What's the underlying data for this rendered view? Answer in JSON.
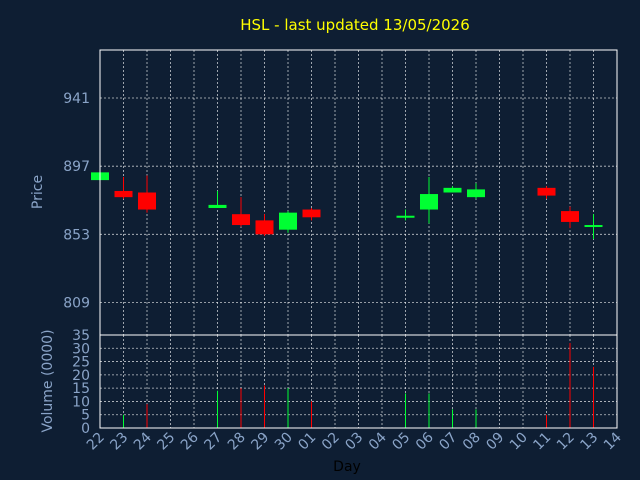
{
  "chart_data": {
    "type": "candlestick",
    "title": "HSL - last updated 13/05/2026",
    "xlabel": "Day",
    "ylabel_price": "Price",
    "ylabel_volume": "Volume (0000)",
    "price_ticks": [
      809,
      853,
      897,
      941
    ],
    "price_range": [
      788,
      972
    ],
    "volume_ticks": [
      0,
      5,
      10,
      15,
      20,
      25,
      30,
      35
    ],
    "volume_range": [
      0,
      35
    ],
    "x_tick_labels": [
      "22",
      "23",
      "24",
      "25",
      "26",
      "27",
      "28",
      "29",
      "30",
      "01",
      "02",
      "03",
      "04",
      "05",
      "06",
      "07",
      "08",
      "09",
      "10",
      "11",
      "12",
      "13",
      "14"
    ],
    "grid": true,
    "colors": {
      "up": "#00ff33",
      "down": "#ff0000",
      "title": "#ffff00",
      "ticks": "#8aa4c8",
      "background": "#0e1e33"
    },
    "candles": [
      {
        "day": "22",
        "open": 888,
        "close": 893,
        "high": 893,
        "low": 888
      },
      {
        "day": "23",
        "open": 881,
        "close": 877,
        "high": 890,
        "low": 876
      },
      {
        "day": "24",
        "open": 880,
        "close": 869,
        "high": 891,
        "low": 867
      },
      {
        "day": "27",
        "open": 870,
        "close": 872,
        "high": 881,
        "low": 870
      },
      {
        "day": "28",
        "open": 866,
        "close": 859,
        "high": 877,
        "low": 858
      },
      {
        "day": "29",
        "open": 862,
        "close": 853,
        "high": 866,
        "low": 852
      },
      {
        "day": "30",
        "open": 856,
        "close": 867,
        "high": 868,
        "low": 854
      },
      {
        "day": "01",
        "open": 869,
        "close": 864,
        "high": 870,
        "low": 862
      },
      {
        "day": "05",
        "open": 864,
        "close": 865,
        "high": 869,
        "low": 862
      },
      {
        "day": "06",
        "open": 869,
        "close": 879,
        "high": 890,
        "low": 860
      },
      {
        "day": "07",
        "open": 880,
        "close": 883,
        "high": 884,
        "low": 880
      },
      {
        "day": "08",
        "open": 877,
        "close": 882,
        "high": 886,
        "low": 876
      },
      {
        "day": "11",
        "open": 883,
        "close": 878,
        "high": 884,
        "low": 876
      },
      {
        "day": "12",
        "open": 868,
        "close": 861,
        "high": 871,
        "low": 857
      },
      {
        "day": "13",
        "open": 859,
        "close": 859,
        "high": 866,
        "low": 850
      }
    ],
    "volumes": [
      {
        "day": "22",
        "value": 0,
        "dir": "up"
      },
      {
        "day": "23",
        "value": 5,
        "dir": "up"
      },
      {
        "day": "24",
        "value": 9,
        "dir": "down"
      },
      {
        "day": "27",
        "value": 14,
        "dir": "up"
      },
      {
        "day": "28",
        "value": 15,
        "dir": "down"
      },
      {
        "day": "29",
        "value": 16,
        "dir": "down"
      },
      {
        "day": "30",
        "value": 15,
        "dir": "up"
      },
      {
        "day": "01",
        "value": 10,
        "dir": "down"
      },
      {
        "day": "05",
        "value": 13,
        "dir": "up"
      },
      {
        "day": "06",
        "value": 13,
        "dir": "up"
      },
      {
        "day": "07",
        "value": 7,
        "dir": "up"
      },
      {
        "day": "08",
        "value": 7,
        "dir": "up"
      },
      {
        "day": "11",
        "value": 5,
        "dir": "down"
      },
      {
        "day": "12",
        "value": 32,
        "dir": "down"
      },
      {
        "day": "13",
        "value": 23,
        "dir": "down"
      }
    ]
  }
}
